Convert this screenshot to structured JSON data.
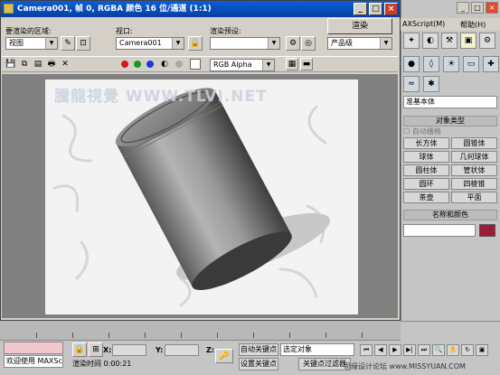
{
  "main_menu": {
    "maxscript": "AXScript(M)",
    "help": "帮助(H)"
  },
  "command_panel": {
    "category_select": "准基本体",
    "object_type_header": "对象类型",
    "auto_grid": "自动栅格",
    "primitives": [
      "长方体",
      "圆锥体",
      "球体",
      "几何球体",
      "圆柱体",
      "管状体",
      "圆环",
      "四棱锥",
      "茶壶",
      "平面"
    ],
    "name_color_header": "名称和颜色",
    "object_color": "#9c1a3a"
  },
  "render_window": {
    "title": "Camera001, 帧 0, RGBA 颜色 16 位/通道 (1:1)",
    "area_label": "要渲染的区域:",
    "area_value": "视图",
    "viewport_label": "视口:",
    "viewport_value": "Camera001",
    "preset_label": "渲染预设:",
    "preset_value": "",
    "render_button": "渲染",
    "quality_value": "产品级",
    "channel_value": "RGB Alpha",
    "channel_colors": [
      "#d21a1a",
      "#1a9a1a",
      "#1a3ad2"
    ],
    "watermark": "騰龍視覺 WWW.TLVI.NET"
  },
  "status_bar": {
    "welcome": "欢迎使用 MAXSc",
    "render_time": "渲染时间  0:00:21",
    "x_label": "X:",
    "y_label": "Y:",
    "z_label": "Z:",
    "auto_key": "自动关键点",
    "set_key": "设置关键点",
    "selection": "选定对象",
    "key_filter": "关键点过滤器",
    "site_watermark": "思缘设计论坛 www.MISSYUAN.COM"
  }
}
